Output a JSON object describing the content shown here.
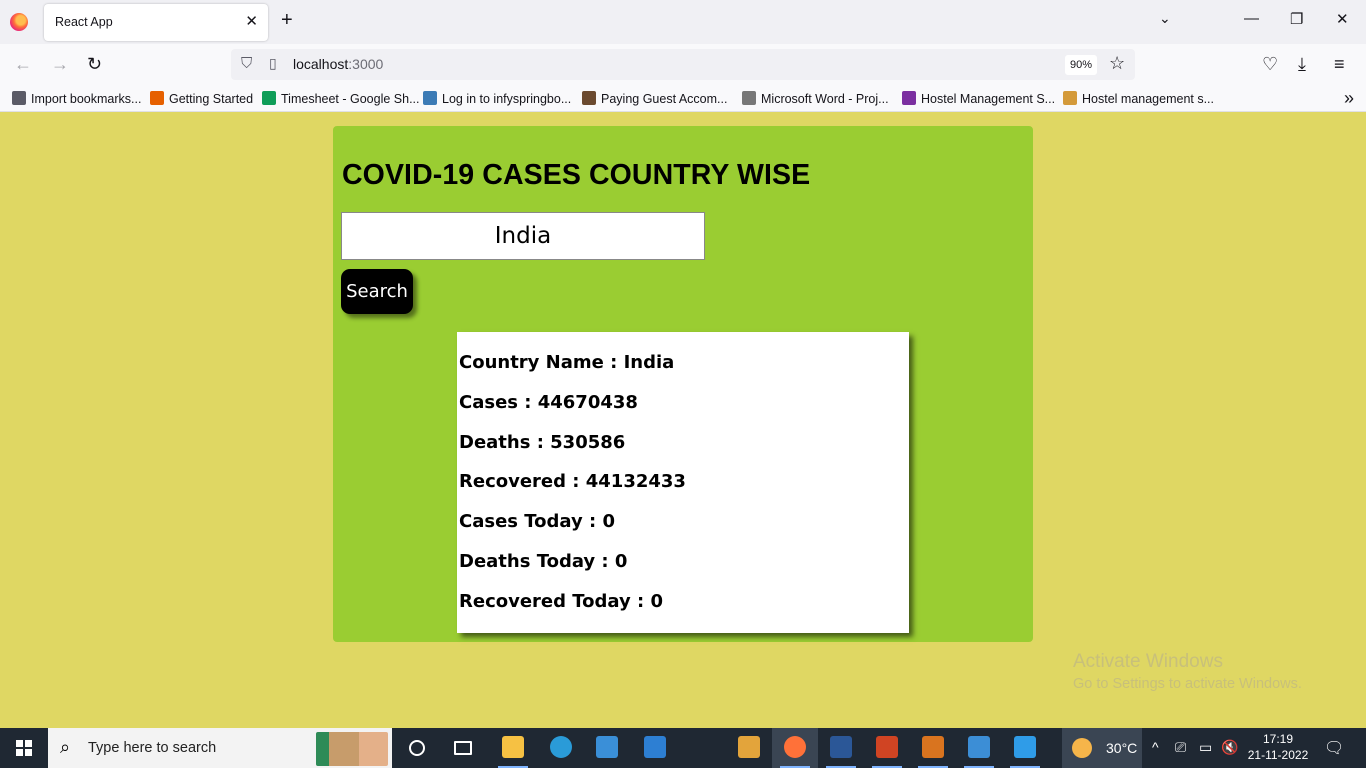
{
  "browser": {
    "tab_title": "React App",
    "tab_close": "✕",
    "new_tab": "+",
    "list_tabs": "⌄",
    "window": {
      "minimize": "—",
      "restore": "❐",
      "close": "✕"
    },
    "nav": {
      "back": "←",
      "forward": "→",
      "reload": "↻"
    },
    "url_host": "localhost",
    "url_port": ":3000",
    "zoom": "90%",
    "bookmark_star": "☆",
    "toolbar": {
      "pocket": "♡",
      "download": "⤓",
      "menu": "≡"
    },
    "bookmarks": [
      {
        "label": "Import bookmarks...",
        "color": "#5b5b66"
      },
      {
        "label": "Getting Started",
        "color": "#e66000"
      },
      {
        "label": "Timesheet - Google Sh...",
        "color": "#0f9d58"
      },
      {
        "label": "Log in to infyspringbo...",
        "color": "#3c7bb5"
      },
      {
        "label": "Paying Guest Accom...",
        "color": "#6b4a2f"
      },
      {
        "label": "Microsoft Word - Proj...",
        "color": "#777777"
      },
      {
        "label": "Hostel Management S...",
        "color": "#7b2fa0"
      },
      {
        "label": "Hostel management s...",
        "color": "#d49a3a"
      }
    ],
    "bookmarks_more": "»"
  },
  "app": {
    "heading": "COVID-19 CASES COUNTRY WISE",
    "search_value": "India",
    "search_button": "Search",
    "accent_color": "#9acd32",
    "page_color": "#dfd763",
    "results": [
      "Country Name : India",
      "Cases : 44670438",
      "Deaths : 530586",
      "Recovered : 44132433",
      "Cases Today : 0",
      "Deaths Today : 0",
      "Recovered Today : 0"
    ]
  },
  "watermark": {
    "line1": "Activate Windows",
    "line2": "Go to Settings to activate Windows."
  },
  "taskbar": {
    "search_placeholder": "Type here to search",
    "search_icon": "⌕",
    "apps": [
      {
        "name": "cortana",
        "color": "#ffffff"
      },
      {
        "name": "task-view",
        "color": "#ffffff"
      },
      {
        "name": "file-explorer",
        "color": "#f6c143"
      },
      {
        "name": "edge",
        "color": "#2a9bd8"
      },
      {
        "name": "store",
        "color": "#3a8fd8"
      },
      {
        "name": "mail",
        "color": "#2d7fd3"
      },
      {
        "name": "app-folder",
        "color": "#e3a43b"
      },
      {
        "name": "firefox",
        "color": "#ff7139"
      },
      {
        "name": "word",
        "color": "#2b5797"
      },
      {
        "name": "powerpoint",
        "color": "#d04423"
      },
      {
        "name": "office-app",
        "color": "#d9741f"
      },
      {
        "name": "photos",
        "color": "#3c8ed6"
      },
      {
        "name": "vscode",
        "color": "#2f9ce8"
      }
    ],
    "weather": "30°C",
    "tray": {
      "chevron": "^",
      "meet": "⎚",
      "battery": "▭",
      "volume": "🔇"
    },
    "time": "17:19",
    "date": "21-11-2022",
    "notifications": "🗨"
  }
}
